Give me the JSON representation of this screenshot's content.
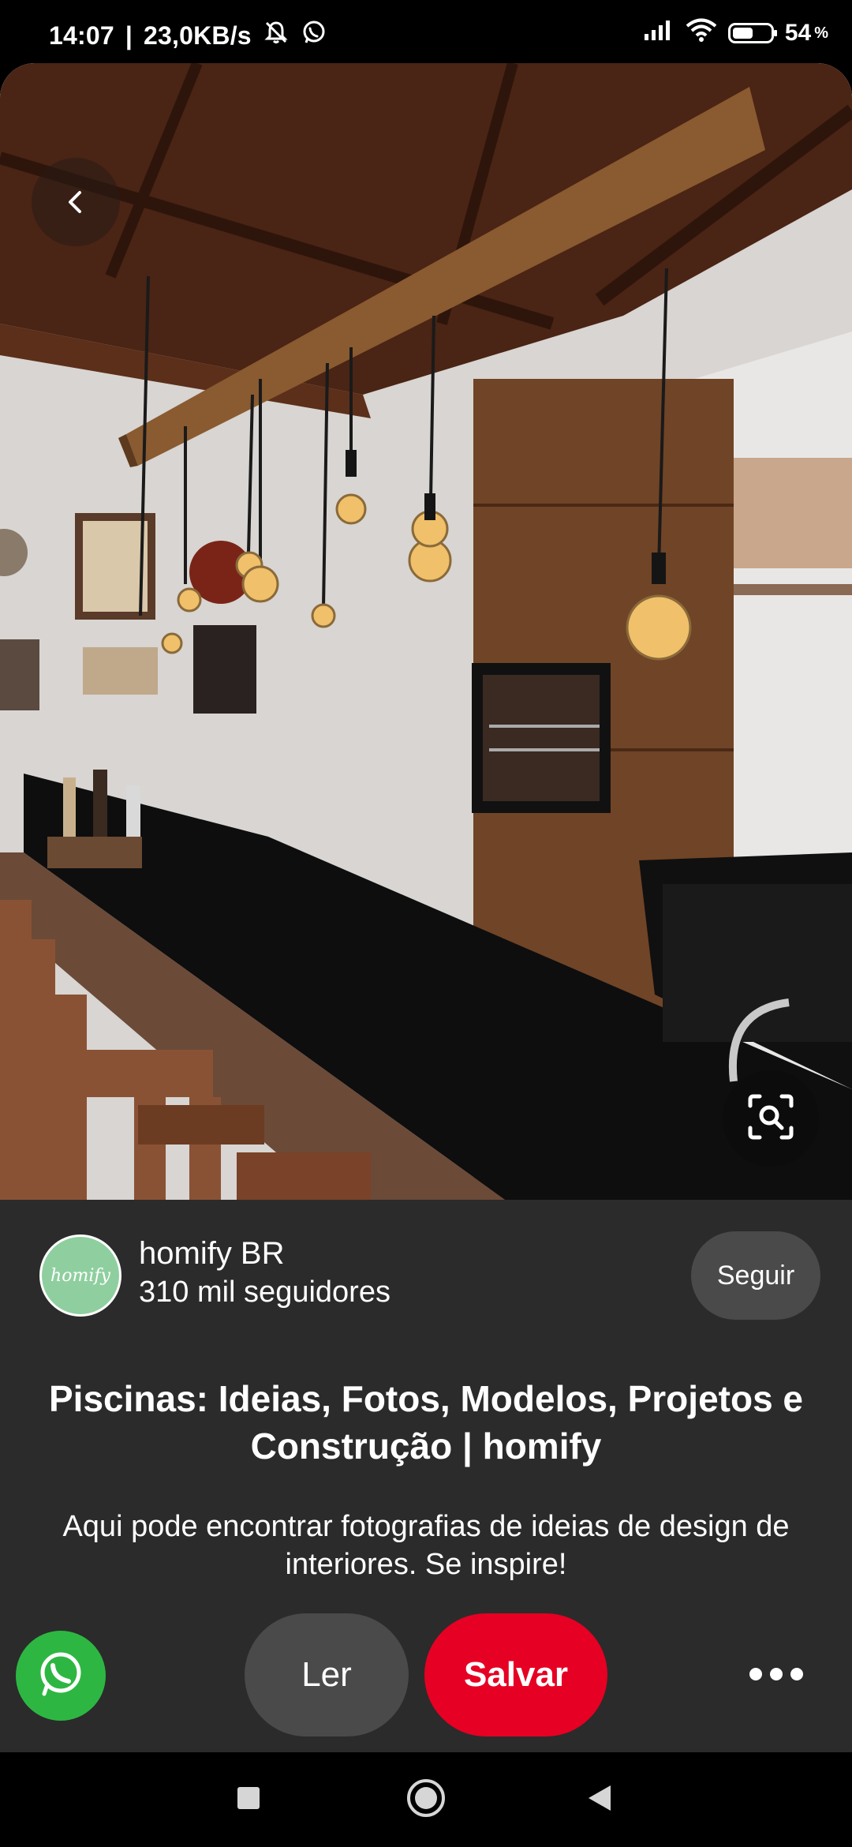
{
  "status_bar": {
    "time": "14:07",
    "network_speed": "23,0KB/s",
    "battery_percent": "54",
    "battery_level": 0.54,
    "icons": [
      "mute-icon",
      "whatsapp-notification-icon",
      "signal-icon",
      "wifi-icon",
      "battery-icon"
    ]
  },
  "hero": {
    "icons": [
      "back-icon",
      "visual-search-icon"
    ]
  },
  "profile": {
    "name": "homify BR",
    "followers": "310 mil seguidores",
    "avatar_text": "homify",
    "avatar_color": "#8fcf9f",
    "follow_label": "Seguir"
  },
  "pin": {
    "title": "Piscinas: Ideias, Fotos, Modelos, Projetos e Construção | homify",
    "description": "Aqui pode encontrar fotografias de ideias de design de interiores. Se inspire!"
  },
  "actions": {
    "read_label": "Ler",
    "save_label": "Salvar",
    "save_color": "#e60023",
    "whatsapp_color": "#2db742"
  },
  "nav": {
    "icons": [
      "recents-icon",
      "home-icon",
      "back-icon"
    ]
  }
}
